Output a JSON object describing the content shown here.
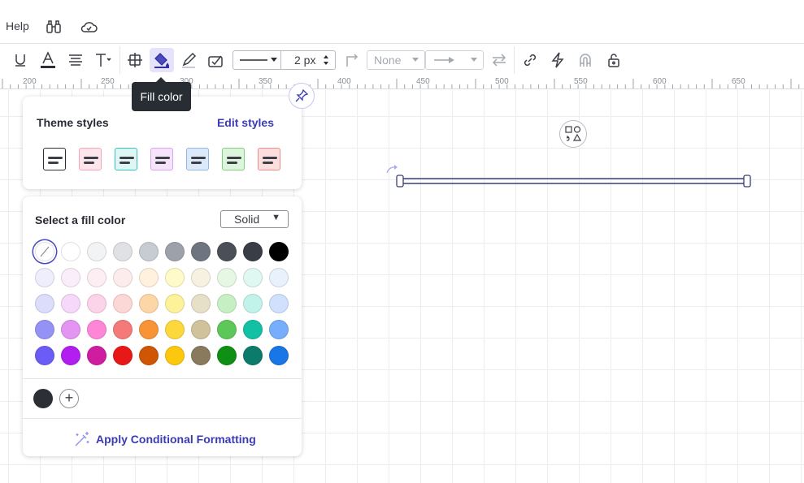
{
  "menu": {
    "help_label": "Help",
    "icons": [
      "binoculars-icon",
      "cloud-icon"
    ]
  },
  "toolbar": {
    "tools": [
      "underline-icon",
      "text-color-icon",
      "align-icon",
      "text-options-icon",
      "shape-options-icon",
      "fill-color-icon",
      "line-color-icon",
      "stamp-icon"
    ],
    "line_width": "2 px",
    "arrow_start": "None",
    "tools_right": [
      "swap-arrows-icon",
      "link-icon",
      "lightning-icon",
      "magnet-icon",
      "lock-icon"
    ],
    "tooltip": "Fill color"
  },
  "ruler": {
    "labels": [
      "200",
      "250",
      "300",
      "350",
      "400",
      "450",
      "500",
      "550",
      "600",
      "650"
    ]
  },
  "theme_panel": {
    "title": "Theme styles",
    "edit_link": "Edit styles",
    "swatches": [
      {
        "bg": "#ffffff",
        "border": "#2c2f36"
      },
      {
        "bg": "#fde6eb",
        "border": "#f4a6b6"
      },
      {
        "bg": "#dff7f4",
        "border": "#36c4b5"
      },
      {
        "bg": "#f4e3fb",
        "border": "#d9a4f0"
      },
      {
        "bg": "#dce9fb",
        "border": "#92b6ea"
      },
      {
        "bg": "#ddf5dc",
        "border": "#7fd27c"
      },
      {
        "bg": "#fddede",
        "border": "#ef8c8c"
      }
    ]
  },
  "fill_panel": {
    "title": "Select a fill color",
    "mode": "Solid",
    "colors": [
      [
        "none",
        "#ffffff",
        "#f2f3f5",
        "#dfe1e5",
        "#c7ccd3",
        "#9da2aa",
        "#6f7580",
        "#4a4f58",
        "#383d46",
        "#000000"
      ],
      [
        "#eeeefc",
        "#fbeefb",
        "#fdeef4",
        "#fdecec",
        "#fff1dd",
        "#fefbc8",
        "#f6f1e0",
        "#e6f7e4",
        "#dff8f2",
        "#e9f1fc"
      ],
      [
        "#dcdcfb",
        "#f5d8fa",
        "#fcd3e8",
        "#fdd6d6",
        "#fdd6a8",
        "#fdf19a",
        "#e7e0c8",
        "#c6f0c4",
        "#c2f3ea",
        "#cfe1fc"
      ],
      [
        "#9493f5",
        "#e494f2",
        "#fd86d6",
        "#f47a7a",
        "#f89336",
        "#fcd83c",
        "#d0c39c",
        "#5ec759",
        "#12c0a4",
        "#76aefb"
      ],
      [
        "#6b5cf5",
        "#b21ef0",
        "#cf1da0",
        "#e81818",
        "#cf5605",
        "#fcc70c",
        "#8a7a5d",
        "#0f8f13",
        "#0c7b6b",
        "#1976e6"
      ]
    ],
    "recent_color": "#2c2f36",
    "conditional_formatting": "Apply Conditional Formatting"
  }
}
